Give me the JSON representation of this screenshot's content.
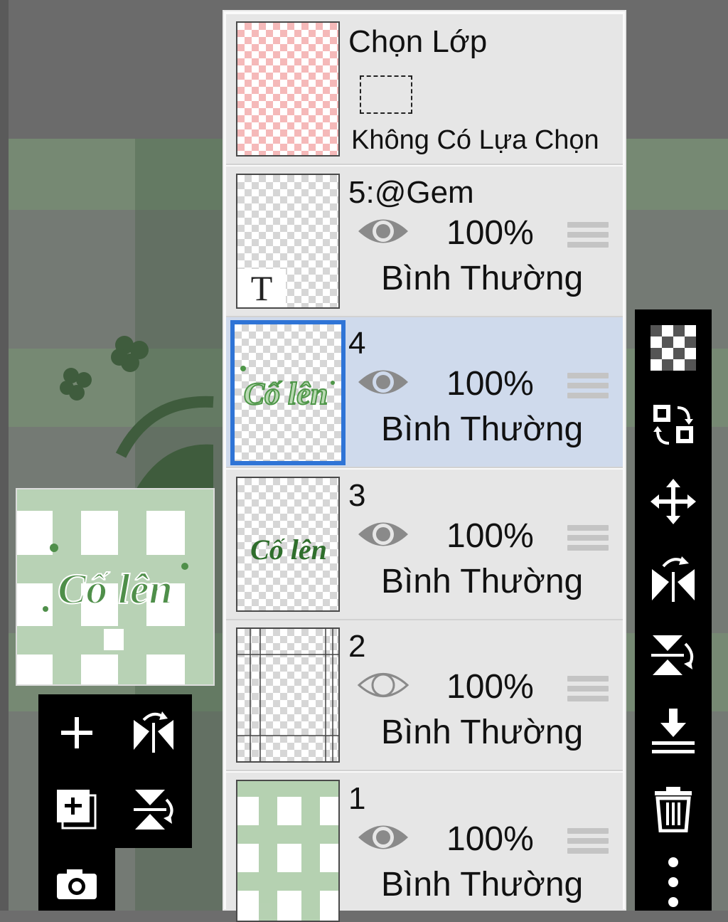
{
  "selection_layer": {
    "title": "Chọn Lớp",
    "status": "Không Có Lựa Chọn"
  },
  "layers": [
    {
      "name": "5:@Gem",
      "opacity": "100%",
      "blend_mode": "Bình Thường",
      "visible": true,
      "type": "text",
      "thumb_glyph": "T"
    },
    {
      "name": "4",
      "opacity": "100%",
      "blend_mode": "Bình Thường",
      "visible": true,
      "selected": true
    },
    {
      "name": "3",
      "opacity": "100%",
      "blend_mode": "Bình Thường",
      "visible": true
    },
    {
      "name": "2",
      "opacity": "100%",
      "blend_mode": "Bình Thường",
      "visible": false
    },
    {
      "name": "1",
      "opacity": "100%",
      "blend_mode": "Bình Thường",
      "visible": true
    }
  ],
  "artwork_text": "Cố lên",
  "left_tools": [
    "add-layer-icon",
    "flip-horizontal-icon",
    "add-layer-copy-icon",
    "flip-vertical-icon",
    "camera-icon"
  ],
  "right_tools": [
    "transparency-icon",
    "swap-layers-icon",
    "move-icon",
    "flip-horizontal-icon",
    "flip-vertical-icon",
    "merge-down-icon",
    "delete-icon",
    "more-icon"
  ],
  "colors": {
    "selected_row": "#cfdaec",
    "selected_border": "#2f74d6",
    "plaid_green": "#8fb48a",
    "art_green": "#3f7a3c"
  }
}
